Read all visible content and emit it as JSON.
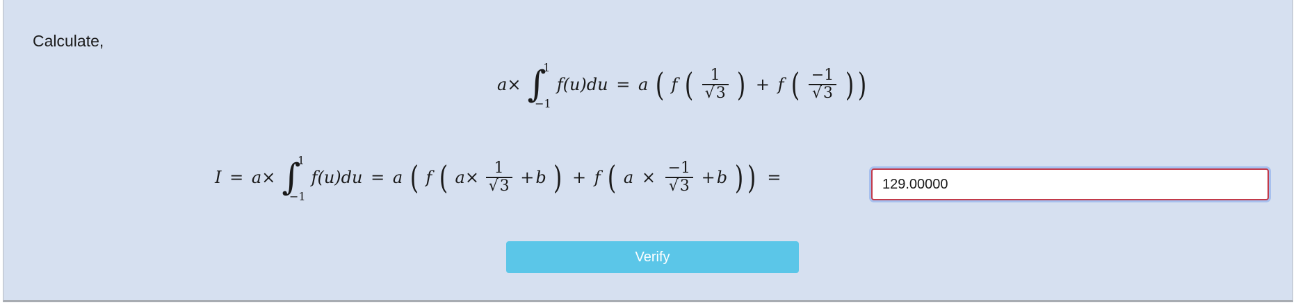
{
  "prompt": "Calculate,",
  "equation1": {
    "lhs_a": "a",
    "times": "×",
    "int_upper": "1",
    "int_lower": "−1",
    "integrand": "f(u)du",
    "equals": "=",
    "coef": "a",
    "f1": "f",
    "frac1_num": "1",
    "frac1_den": "3",
    "plus": "+",
    "f2": "f",
    "frac2_num": "−1",
    "frac2_den": "3"
  },
  "equation2": {
    "I": "I",
    "eq": "=",
    "a": "a",
    "times": "×",
    "int_upper": "1",
    "int_lower": "−1",
    "integrand": "f(u)du",
    "eq2": "=",
    "coef": "a",
    "f1": "f",
    "inner_a1": "a",
    "times1": "×",
    "frac1_num": "1",
    "frac1_den": "3",
    "plus_b1": "+",
    "b1": "b",
    "plus": "+",
    "f2": "f",
    "inner_a2": "a",
    "times2": "×",
    "frac2_num": "−1",
    "frac2_den": "3",
    "plus_b2": "+",
    "b2": "b",
    "final_eq": "="
  },
  "answer_input": {
    "value": "129.00000"
  },
  "verify_button": {
    "label": "Verify"
  }
}
